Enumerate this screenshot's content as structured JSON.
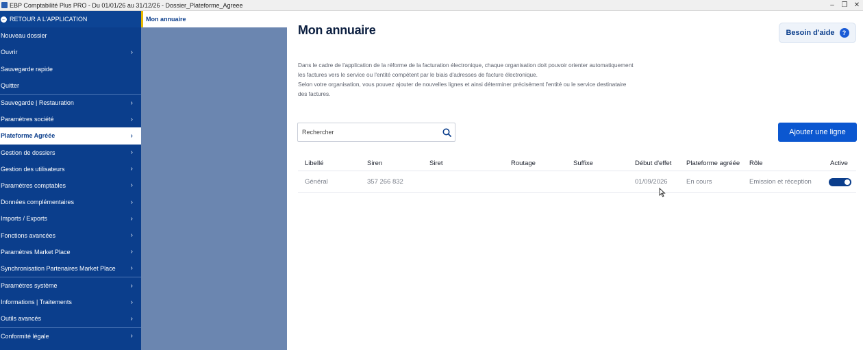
{
  "window": {
    "title": "EBP Comptabilité Plus PRO - Du 01/01/26 au 31/12/26 - Dossier_Plateforme_Agreee",
    "minimize": "‒",
    "restore": "❐",
    "close": "✕"
  },
  "sidebar": {
    "back_label": "RETOUR A L'APPLICATION",
    "items": [
      {
        "label": "Nouveau dossier",
        "chevron": ""
      },
      {
        "label": "Ouvrir",
        "chevron": "›"
      },
      {
        "label": "Sauvegarde rapide",
        "chevron": ""
      },
      {
        "label": "Quitter",
        "chevron": ""
      },
      {
        "label": "Sauvegarde | Restauration",
        "chevron": "›"
      },
      {
        "label": "Paramètres société",
        "chevron": "›"
      },
      {
        "label": "Plateforme Agréée",
        "chevron": "›"
      },
      {
        "label": "Gestion de dossiers",
        "chevron": "›"
      },
      {
        "label": "Gestion des utilisateurs",
        "chevron": "›"
      },
      {
        "label": "Paramètres comptables",
        "chevron": "›"
      },
      {
        "label": "Données complémentaires",
        "chevron": "›"
      },
      {
        "label": "Imports / Exports",
        "chevron": "›"
      },
      {
        "label": "Fonctions avancées",
        "chevron": "›"
      },
      {
        "label": "Paramètres Market Place",
        "chevron": "›"
      },
      {
        "label": "Synchronisation Partenaires Market Place",
        "chevron": "›"
      },
      {
        "label": "Paramètres système",
        "chevron": "›"
      },
      {
        "label": "Informations | Traitements",
        "chevron": "›"
      },
      {
        "label": "Outils avancés",
        "chevron": "›"
      },
      {
        "label": "Conformité légale",
        "chevron": "›"
      }
    ]
  },
  "subpanel": {
    "selected": "Mon annuaire"
  },
  "main": {
    "title": "Mon annuaire",
    "help_label": "Besoin d'aide",
    "help_icon": "?",
    "description": [
      "Dans le cadre de l'application de la réforme de la facturation électronique, chaque organisation doit pouvoir orienter automatiquement",
      "les factures vers le service ou l'entité compétent par le biais d'adresses de facture électronique.",
      "Selon votre organisation, vous pouvez ajouter de nouvelles lignes et ainsi déterminer précisément l'entité ou le service destinataire",
      "des factures."
    ],
    "search_placeholder": "Rechercher",
    "add_label": "Ajouter une ligne",
    "table": {
      "headers": [
        "Libellé",
        "Siren",
        "Siret",
        "Routage",
        "Suffixe",
        "Début d'effet",
        "Plateforme agréée",
        "Rôle",
        "Active"
      ],
      "rows": [
        {
          "libelle": "Général",
          "siren": "357 266 832",
          "siret": "",
          "routage": "",
          "suffixe": "",
          "debut": "01/09/2026",
          "plateforme": "En cours",
          "role": "Emission et réception",
          "active": true
        }
      ]
    }
  },
  "colors": {
    "sidebar_bg": "#0b3e8c",
    "subpanel_bg": "#6b86b0",
    "primary_button": "#0b57d0",
    "accent_bar": "#e6b800"
  }
}
